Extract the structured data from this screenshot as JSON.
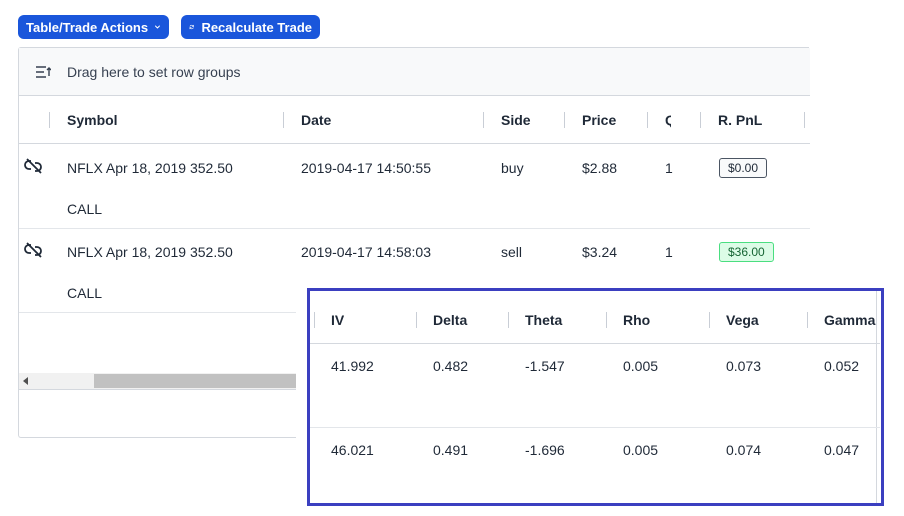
{
  "toolbar": {
    "actions_label": "Table/Trade Actions",
    "recalc_label": "Recalculate Trade"
  },
  "grid": {
    "group_bar_text": "Drag here to set row groups",
    "columns": [
      "Symbol",
      "Date",
      "Side",
      "Price",
      "Q",
      "R. PnL"
    ],
    "rows": [
      {
        "symbol_line1": "NFLX Apr 18, 2019 352.50",
        "symbol_line2": "CALL",
        "date": "2019-04-17 14:50:55",
        "side": "buy",
        "price": "$2.88",
        "qty": "1",
        "rpnl": "$0.00"
      },
      {
        "symbol_line1": "NFLX Apr 18, 2019 352.50",
        "symbol_line2": "CALL",
        "date": "2019-04-17 14:58:03",
        "side": "sell",
        "price": "$3.24",
        "qty": "1",
        "rpnl": "$36.00"
      }
    ]
  },
  "greeks": {
    "columns": [
      "IV",
      "Delta",
      "Theta",
      "Rho",
      "Vega",
      "Gamma"
    ],
    "rows": [
      {
        "iv": "41.992",
        "delta": "0.482",
        "theta": "-1.547",
        "rho": "0.005",
        "vega": "0.073",
        "gamma": "0.052"
      },
      {
        "iv": "46.021",
        "delta": "0.491",
        "theta": "-1.696",
        "rho": "0.005",
        "vega": "0.074",
        "gamma": "0.047"
      }
    ]
  },
  "icons": {
    "chevron": "chevron-down-icon",
    "refresh": "refresh-icon",
    "row_group": "row-group-icon",
    "unlink": "unlink-icon"
  },
  "colors": {
    "primary": "#1a56db",
    "highlight_border": "#3b3fc0",
    "positive_bg": "#dcfce7",
    "positive_border": "#4ade80"
  }
}
